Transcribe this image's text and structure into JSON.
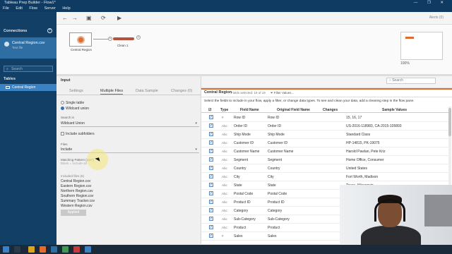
{
  "window": {
    "title": "Tableau Prep Builder - Flow1*",
    "controls": "—  ❐  ✕"
  },
  "menu": [
    "File",
    "Edit",
    "Flow",
    "Server",
    "Help"
  ],
  "sidebar": {
    "connections_label": "Connections",
    "connection": {
      "name": "Central Region.csv",
      "subtitle": "Text file"
    },
    "search_placeholder": "Search",
    "tables_label": "Tables",
    "table_item": "Central Region"
  },
  "toolbar": {
    "alerts": "Alerts (0)"
  },
  "flow": {
    "input_node_label": "Central Region",
    "clean_node_label": "Clean 1",
    "zoom": "100%"
  },
  "input_panel": {
    "title": "Input",
    "tabs": [
      "Settings",
      "Multiple Files",
      "Data Sample",
      "Changes (0)"
    ],
    "active_tab": 1,
    "radio_single": "Single table",
    "radio_wildcard": "Wildcard union",
    "search_in_label": "Search in",
    "search_in_value": "Wildcard Union",
    "include_subfolders": "Include subfolders",
    "files_label": "Files",
    "files_value": "Include",
    "matching_label": "Matching Pattern (xxx*)",
    "matching_hint": "Blank = Include all",
    "included_files_label": "Included files (6)",
    "included_files": [
      "Central Region.csv",
      "Eastern Region.csv",
      "Northern Region.csv",
      "Southern Region.csv",
      "Summary Tracker.csv",
      "Western Region.csv"
    ],
    "apply_label": "Applied"
  },
  "data_panel": {
    "search_placeholder": "Search",
    "table_name": "Central Region",
    "field_count": "Fields selected: 19 of 19",
    "filter_label": "Filter Values...",
    "description": "Select the fields to include in your flow, apply a filter, or change data types. To see and clean your data, add a cleaning step in the flow pane.",
    "columns": [
      "Type",
      "Field Name",
      "Original Field Name",
      "Changes",
      "Sample Values"
    ],
    "rows": [
      {
        "type": "#",
        "field": "Row ID",
        "original": "Row ID",
        "sample": "15, 16, 17"
      },
      {
        "type": "Abc",
        "field": "Order ID",
        "original": "Order ID",
        "sample": "US-2016-118983, CA-2015-105893"
      },
      {
        "type": "Abc",
        "field": "Ship Mode",
        "original": "Ship Mode",
        "sample": "Standard Class"
      },
      {
        "type": "Abc",
        "field": "Customer ID",
        "original": "Customer ID",
        "sample": "HP-14815, PK-19075"
      },
      {
        "type": "Abc",
        "field": "Customer Name",
        "original": "Customer Name",
        "sample": "Harold Pawlan, Pete Kriz"
      },
      {
        "type": "Abc",
        "field": "Segment",
        "original": "Segment",
        "sample": "Home Office, Consumer"
      },
      {
        "type": "Abc",
        "field": "Country",
        "original": "Country",
        "sample": "United States"
      },
      {
        "type": "Abc",
        "field": "City",
        "original": "City",
        "sample": "Fort Worth, Madison"
      },
      {
        "type": "Abc",
        "field": "State",
        "original": "State",
        "sample": "Texas, Wisconsin"
      },
      {
        "type": "Abc",
        "field": "Postal Code",
        "original": "Postal Code",
        "sample": ""
      },
      {
        "type": "Abc",
        "field": "Product ID",
        "original": "Product ID",
        "sample": ""
      },
      {
        "type": "Abc",
        "field": "Category",
        "original": "Category",
        "sample": ""
      },
      {
        "type": "Abc",
        "field": "Sub-Category",
        "original": "Sub-Category",
        "sample": ""
      },
      {
        "type": "Abc",
        "field": "Product",
        "original": "Product",
        "sample": ""
      },
      {
        "type": "#",
        "field": "Sales",
        "original": "Sales",
        "sample": ""
      }
    ]
  },
  "colors": {
    "sidebar": "#123f66",
    "accent": "#3b82c4",
    "orange": "#e06d2f"
  }
}
